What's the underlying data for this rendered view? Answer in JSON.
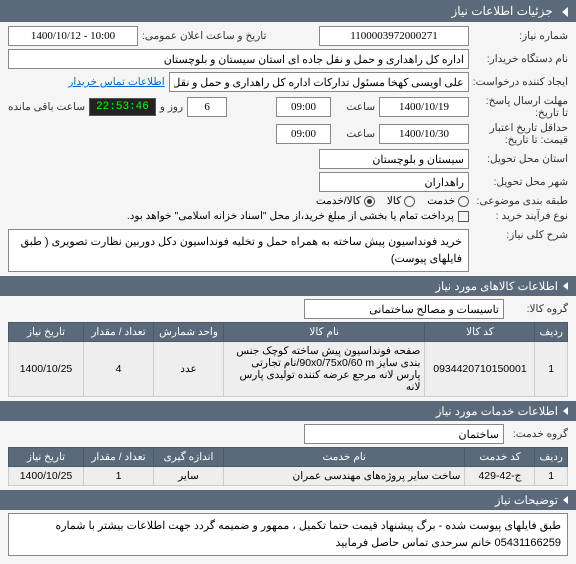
{
  "header": {
    "title": "جزئیات اطلاعات نیاز"
  },
  "form": {
    "reqNumLabel": "شماره نیاز:",
    "reqNum": "1100003972000271",
    "announceLabel": "تاریخ و ساعت اعلان عمومی:",
    "announce": "1400/10/12 - 10:00",
    "buyerLabel": "نام دستگاه خریدار:",
    "buyer": "اداره کل راهداری و حمل و نقل جاده ای استان سیستان و بلوچستان",
    "requesterLabel": "ایجاد کننده درخواست:",
    "requester": "علی اویسی کهخا مسئول تدارکات اداره کل راهداری و حمل و نقل جاده ای اس",
    "buyerInfoLink": "اطلاعات تماس خریدار",
    "replyLabel": "مهلت ارسال پاسخ:",
    "replyDeadlineLabel": "تا تاریخ:",
    "replyDate": "1400/10/19",
    "timeLabel": "ساعت",
    "replyTime": "09:00",
    "daysCount": "6",
    "daysAnd": "روز و",
    "countdown": "22:53:46",
    "remainLabel": "ساعت باقی مانده",
    "validLabel": "حداقل تاریخ اعتبار",
    "validLabel2": "قیمت: تا تاریخ:",
    "validDate": "1400/10/30",
    "validTime": "09:00",
    "provLabel": "استان محل تحویل:",
    "prov": "سیستان و بلوچستان",
    "cityLabel": "شهر محل تحویل:",
    "city": "راهداران",
    "catLabel": "طبقه بندی موضوعی:",
    "catService": "خدمت",
    "catGoods": "کالا",
    "catBoth": "کالا/خدمت",
    "buyTypeLabel": "نوع فرآیند خرید :",
    "buyTypeDesc": "پرداخت تمام یا بخشی از مبلغ خرید،از محل \"اسناد خزانه اسلامی\" خواهد بود."
  },
  "desc": {
    "label": "شرح کلی نیاز:",
    "text": "خرید فونداسیون پیش ساخته به همراه حمل و تخلیه فونداسیون دکل دوربین نظارت تصویری ( طبق فایلهای پیوست)"
  },
  "goods": {
    "title": "اطلاعات کالاهای مورد نیاز",
    "groupLabel": "گروه کالا:",
    "group": "تاسیسات و مصالح ساختمانی",
    "cols": {
      "row": "ردیف",
      "code": "کد کالا",
      "name": "نام کالا",
      "unit": "واحد شمارش",
      "qty": "تعداد / مقدار",
      "date": "تاریخ نیاز"
    },
    "rows": [
      {
        "idx": "1",
        "code": "0934420710150001",
        "name": "صفحه فونداسیون پیش ساخته کوچک جنس بندی سایز 90x0/75x0/60 m/نام تجارتی پارس لانه مرجع عرضه کننده تولیدی پارس لانه",
        "unit": "عدد",
        "qty": "4",
        "date": "1400/10/25"
      }
    ]
  },
  "services": {
    "title": "اطلاعات خدمات مورد نیاز",
    "groupLabel": "گروه خدمت:",
    "group": "ساختمان",
    "cols": {
      "row": "ردیف",
      "code": "کد خدمت",
      "name": "نام خدمت",
      "unit": "اندازه گیری",
      "qty": "تعداد / مقدار",
      "date": "تاریخ نیاز"
    },
    "rows": [
      {
        "idx": "1",
        "code": "ج-42-429",
        "name": "ساخت سایر پروژه‌های مهندسی عمران",
        "unit": "سایر",
        "qty": "1",
        "date": "1400/10/25"
      }
    ]
  },
  "notes": {
    "title": "توضیحات نیاز",
    "text": "طبق فایلهای پیوست شده - برگ پیشنهاد قیمت حتما تکمیل ، ممهور و ضمیمه گردد جهت اطلاعات بیشتر با شماره 05431166259 خانم سرحدی تماس حاصل فرمایید"
  }
}
